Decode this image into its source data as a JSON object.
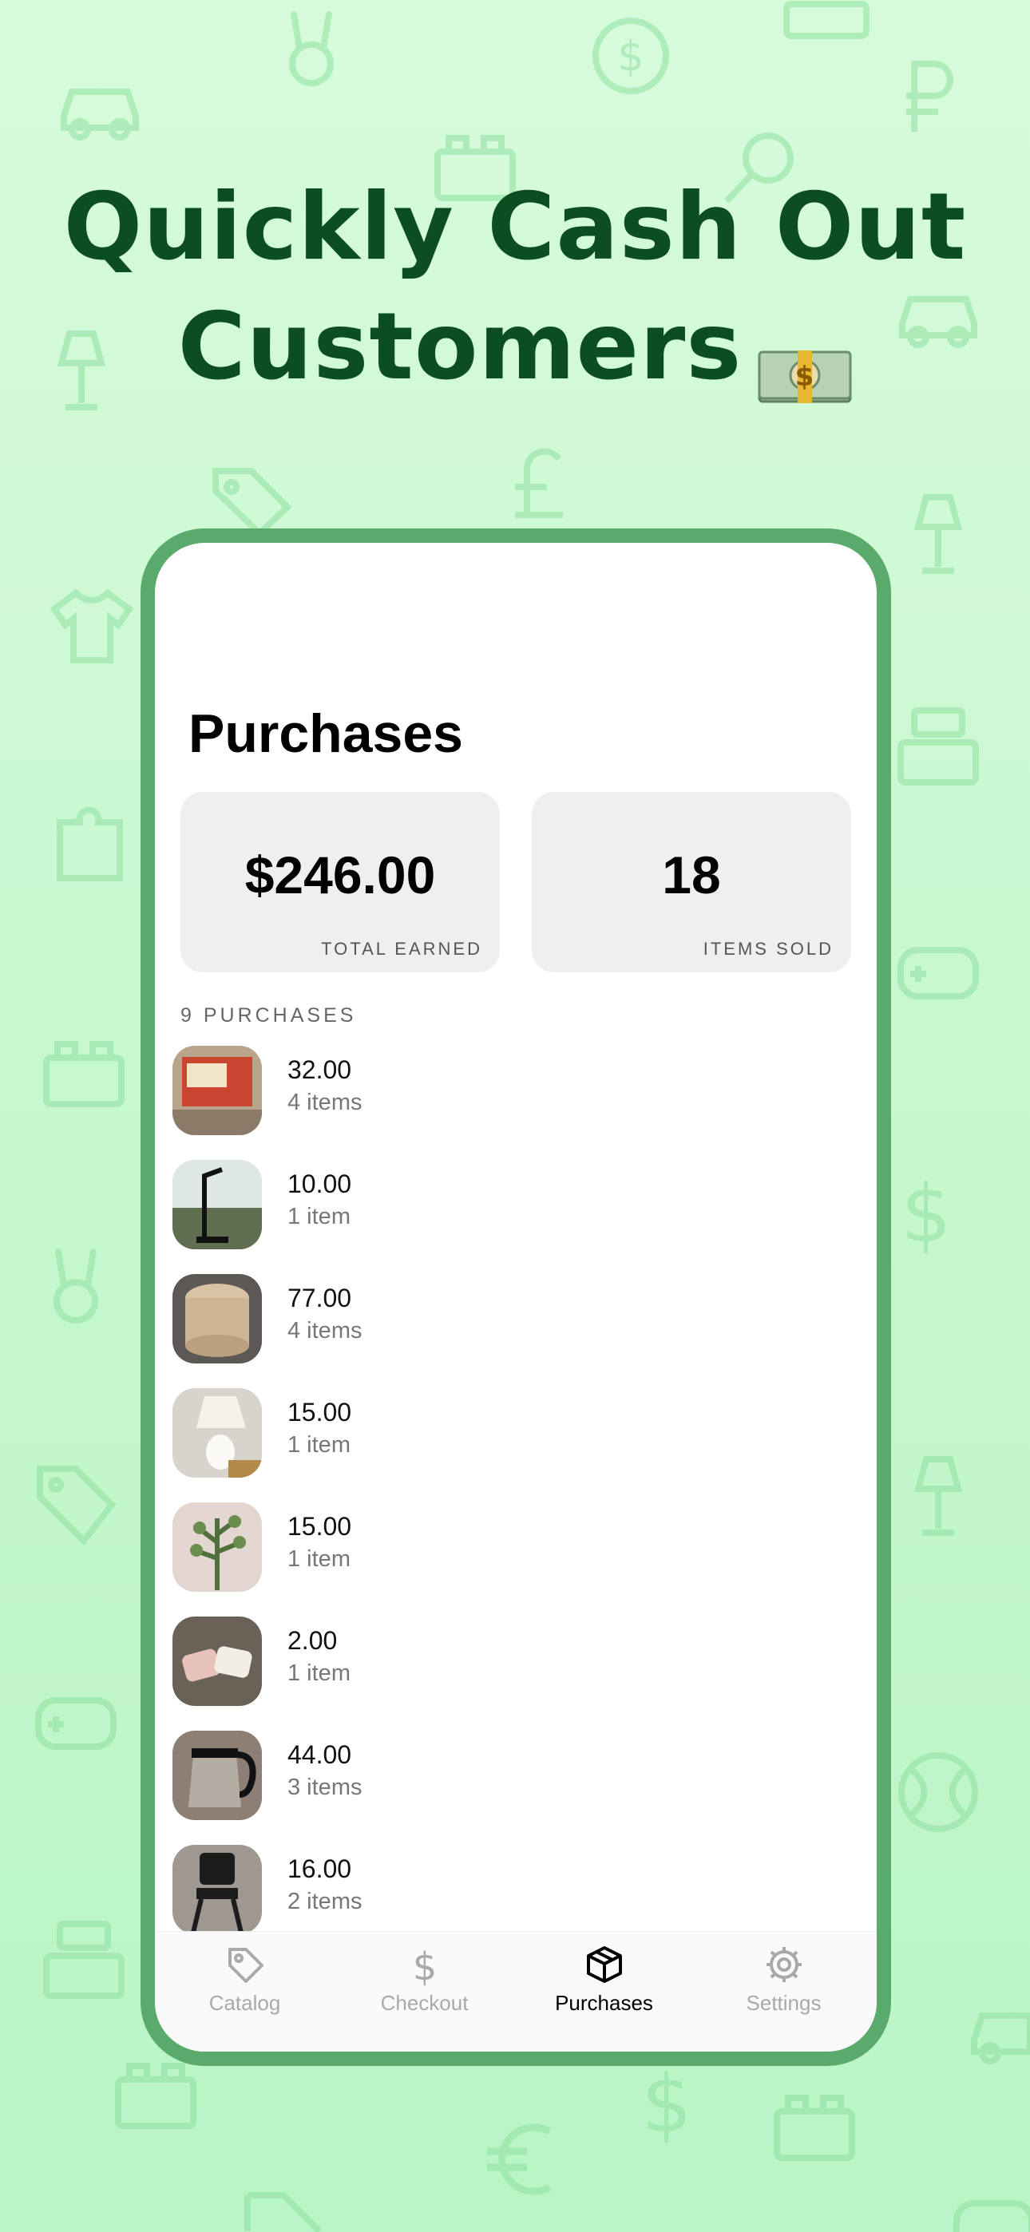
{
  "headline": {
    "line1": "Quickly Cash Out",
    "line2": "Customers"
  },
  "screen": {
    "title": "Purchases",
    "stats": [
      {
        "value": "$246.00",
        "label": "TOTAL EARNED"
      },
      {
        "value": "18",
        "label": "ITEMS SOLD"
      }
    ],
    "section_header": "9 PURCHASES",
    "purchases": [
      {
        "amount": "32.00",
        "items": "4 items",
        "thumb": "box-photo"
      },
      {
        "amount": "10.00",
        "items": "1 item",
        "thumb": "lamp-window-photo"
      },
      {
        "amount": "77.00",
        "items": "4 items",
        "thumb": "wood-stack-photo"
      },
      {
        "amount": "15.00",
        "items": "1 item",
        "thumb": "white-lamp-photo"
      },
      {
        "amount": "15.00",
        "items": "1 item",
        "thumb": "plant-photo"
      },
      {
        "amount": "2.00",
        "items": "1 item",
        "thumb": "pillows-photo"
      },
      {
        "amount": "44.00",
        "items": "3 items",
        "thumb": "kettle-photo"
      },
      {
        "amount": "16.00",
        "items": "2 items",
        "thumb": "chair-photo"
      }
    ],
    "tabs": [
      {
        "label": "Catalog",
        "icon": "tag-icon"
      },
      {
        "label": "Checkout",
        "icon": "dollar-icon"
      },
      {
        "label": "Purchases",
        "icon": "box-icon",
        "active": true
      },
      {
        "label": "Settings",
        "icon": "gear-icon"
      }
    ]
  },
  "colors": {
    "headline": "#0d4d22",
    "frame": "#5aaa6c",
    "background": "#c8f8d0",
    "card": "#efefef"
  }
}
